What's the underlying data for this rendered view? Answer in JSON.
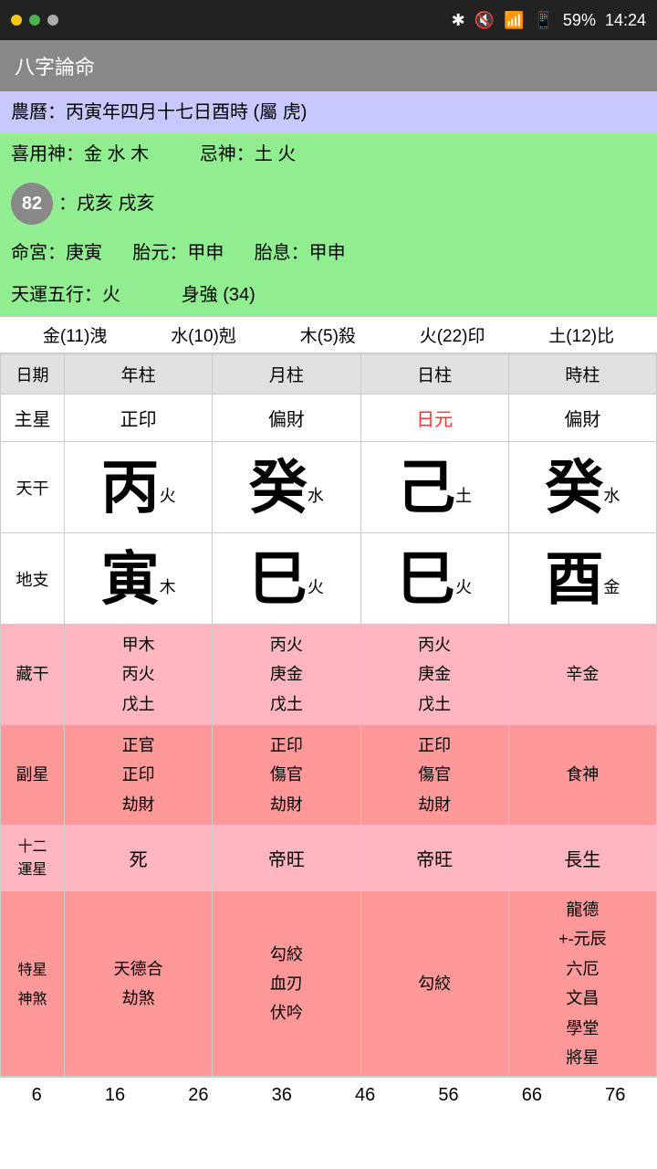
{
  "statusBar": {
    "battery": "59%",
    "time": "14:24"
  },
  "titleBar": {
    "title": "八字論命"
  },
  "infoRows": {
    "lunarDate": "農曆：丙寅年四月十七日酉時 (屬 虎)",
    "favorableGods": "喜用神：金 水 木",
    "avoidGods": "忌神：土 火",
    "score": "82",
    "nayin": "：戌亥 戌亥",
    "lifePalace": "命宮：庚寅",
    "fetal1": "胎元：甲申",
    "fetal2": "胎息：甲申",
    "heavenlyLuck": "天運五行：火",
    "bodyStrength": "身強 (34)"
  },
  "fiveElements": [
    "金(11)洩",
    "水(10)剋",
    "木(5)殺",
    "火(22)印",
    "土(12)比"
  ],
  "tableHeaders": [
    "日期",
    "年柱",
    "月柱",
    "日柱",
    "時柱"
  ],
  "mainStar": {
    "label": "主星",
    "values": [
      "正印",
      "偏財",
      "日元",
      "偏財"
    ],
    "redIndex": 2
  },
  "tianGan": {
    "label": "天干",
    "chars": [
      "丙",
      "癸",
      "己",
      "癸"
    ],
    "elements": [
      "火",
      "水",
      "土",
      "水"
    ]
  },
  "diZhi": {
    "label": "地支",
    "chars": [
      "寅",
      "巳",
      "巳",
      "酉"
    ],
    "elements": [
      "木",
      "火",
      "火",
      "金"
    ]
  },
  "cangGan": {
    "label": "藏干",
    "columns": [
      [
        "甲木",
        "丙火",
        "戊土"
      ],
      [
        "丙火",
        "庚金",
        "戊土"
      ],
      [
        "丙火",
        "庚金",
        "戊土"
      ],
      [
        "辛金",
        "",
        ""
      ]
    ]
  },
  "fuXing": {
    "label": "副星",
    "columns": [
      [
        "正官",
        "正印",
        "劫財"
      ],
      [
        "正印",
        "傷官",
        "劫財"
      ],
      [
        "正印",
        "傷官",
        "劫財"
      ],
      [
        "食神",
        "",
        ""
      ]
    ]
  },
  "yunXing": {
    "label": "十二\n運星",
    "values": [
      "死",
      "帝旺",
      "帝旺",
      "長生"
    ]
  },
  "specialStars": {
    "label": "特星\n神煞",
    "columns": [
      [
        "天德合",
        "劫煞"
      ],
      [
        "勾絞",
        "血刃",
        "伏吟"
      ],
      [
        "勾絞",
        "",
        ""
      ],
      [
        "龍德",
        "+-元辰",
        "六厄",
        "文昌",
        "學堂",
        "將星"
      ]
    ]
  },
  "bottomNumbers": [
    "6",
    "16",
    "26",
    "36",
    "46",
    "56",
    "66",
    "76"
  ]
}
